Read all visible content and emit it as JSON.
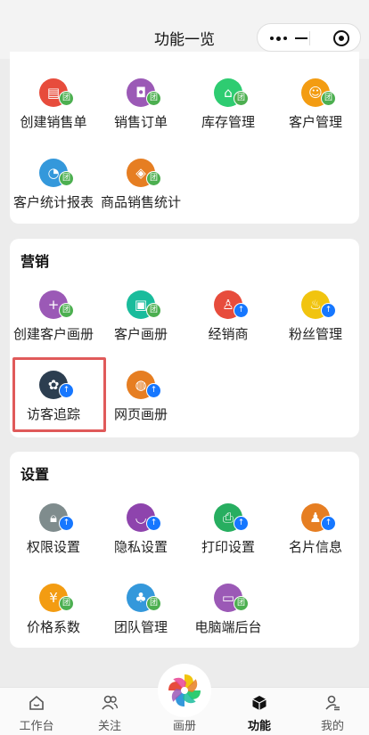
{
  "header": {
    "title": "功能一览"
  },
  "sections": {
    "top": {
      "items": [
        {
          "label": "创建销售单",
          "icon": "sales-order-icon",
          "color": "#e74c3c",
          "badge": "团"
        },
        {
          "label": "销售订单",
          "icon": "wallet-icon",
          "color": "#9b59b6",
          "badge": "团"
        },
        {
          "label": "库存管理",
          "icon": "warehouse-icon",
          "color": "#2ecc71",
          "badge": "团"
        },
        {
          "label": "客户管理",
          "icon": "customer-icon",
          "color": "#f39c12",
          "badge": "团"
        },
        {
          "label": "客户统计报表",
          "icon": "chart-icon",
          "color": "#3498db",
          "badge": "团"
        },
        {
          "label": "商品销售统计",
          "icon": "tag-icon",
          "color": "#e67e22",
          "badge": "团"
        }
      ]
    },
    "marketing": {
      "title": "营销",
      "items": [
        {
          "label": "创建客户画册",
          "icon": "plus-icon",
          "color": "#9b59b6",
          "badge": "团"
        },
        {
          "label": "客户画册",
          "icon": "image-icon",
          "color": "#1abc9c",
          "badge": "团"
        },
        {
          "label": "经销商",
          "icon": "dealer-icon",
          "color": "#e74c3c",
          "badge": "↑"
        },
        {
          "label": "粉丝管理",
          "icon": "fire-icon",
          "color": "#f1c40f",
          "badge": "↑"
        },
        {
          "label": "访客追踪",
          "icon": "footprint-icon",
          "color": "#2c3e50",
          "badge": "↑"
        },
        {
          "label": "网页画册",
          "icon": "globe-icon",
          "color": "#e67e22",
          "badge": "↑"
        }
      ]
    },
    "settings": {
      "title": "设置",
      "items": [
        {
          "label": "权限设置",
          "icon": "lock-icon",
          "color": "#7f8c8d",
          "badge": "↑"
        },
        {
          "label": "隐私设置",
          "icon": "eye-closed-icon",
          "color": "#8e44ad",
          "badge": "↑"
        },
        {
          "label": "打印设置",
          "icon": "printer-icon",
          "color": "#27ae60",
          "badge": "↑"
        },
        {
          "label": "名片信息",
          "icon": "card-icon",
          "color": "#e67e22",
          "badge": "↑"
        },
        {
          "label": "价格系数",
          "icon": "yen-icon",
          "color": "#f39c12",
          "badge": "团"
        },
        {
          "label": "团队管理",
          "icon": "team-icon",
          "color": "#3498db",
          "badge": "团"
        },
        {
          "label": "电脑端后台",
          "icon": "monitor-icon",
          "color": "#9b59b6",
          "badge": "团"
        }
      ]
    }
  },
  "tabbar": {
    "items": [
      {
        "label": "工作台",
        "icon": "home-icon"
      },
      {
        "label": "关注",
        "icon": "follow-icon"
      },
      {
        "label": "画册",
        "icon": "album-icon"
      },
      {
        "label": "功能",
        "icon": "cube-icon",
        "active": true
      },
      {
        "label": "我的",
        "icon": "profile-icon"
      }
    ]
  }
}
